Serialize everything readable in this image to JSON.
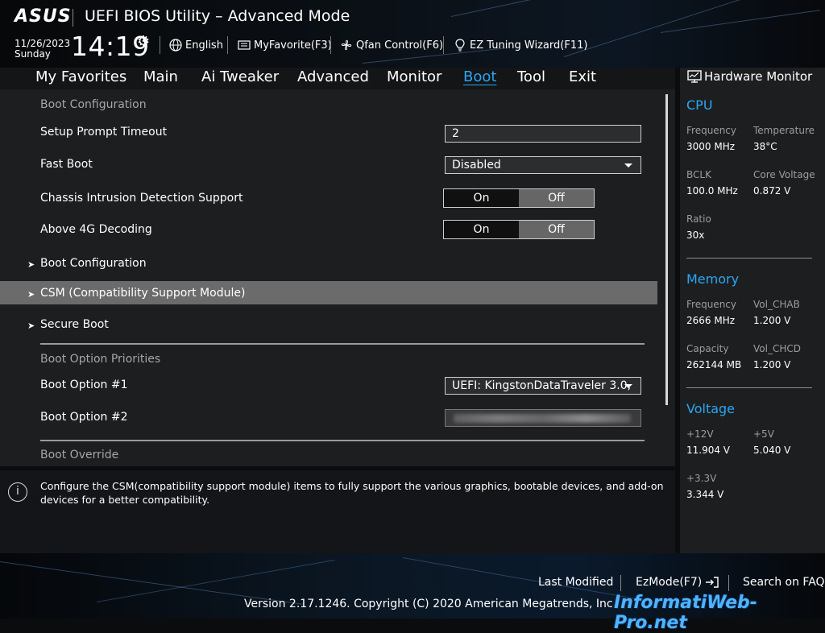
{
  "header": {
    "logo_text": "ASUS",
    "title": "UEFI BIOS Utility – Advanced Mode",
    "date": "11/26/2023",
    "day": "Sunday",
    "time": "14:19",
    "language_label": "English",
    "myfavorite_label": "MyFavorite(F3)",
    "qfan_label": "Qfan Control(F6)",
    "ez_tuning_label": "EZ Tuning Wizard(F11)"
  },
  "nav": {
    "tabs": [
      "My Favorites",
      "Main",
      "Ai Tweaker",
      "Advanced",
      "Monitor",
      "Boot",
      "Tool",
      "Exit"
    ],
    "active": "Boot"
  },
  "boot": {
    "section_boot_configuration": "Boot Configuration",
    "setup_prompt_timeout": {
      "label": "Setup Prompt Timeout",
      "value": "2"
    },
    "fast_boot": {
      "label": "Fast Boot",
      "value": "Disabled"
    },
    "chassis_intrusion": {
      "label": "Chassis Intrusion Detection Support",
      "on": "On",
      "off": "Off",
      "selected": "Off"
    },
    "above_4g": {
      "label": "Above 4G Decoding",
      "on": "On",
      "off": "Off",
      "selected": "Off"
    },
    "submenus": [
      "Boot Configuration",
      "CSM (Compatibility Support Module)",
      "Secure Boot"
    ],
    "highlighted_submenu": "CSM (Compatibility Support Module)",
    "section_boot_option_priorities": "Boot Option Priorities",
    "boot_option_1": {
      "label": "Boot Option #1",
      "value": "UEFI: KingstonDataTraveler 3.0,"
    },
    "boot_option_2": {
      "label": "Boot Option #2"
    },
    "section_boot_override": "Boot Override"
  },
  "help": {
    "text": "Configure the CSM(compatibility support module) items to fully support the various graphics, bootable devices, and add-on devices for a better compatibility."
  },
  "hardware_monitor": {
    "title": "Hardware Monitor",
    "cpu": {
      "heading": "CPU",
      "frequency_label": "Frequency",
      "frequency": "3000 MHz",
      "temperature_label": "Temperature",
      "temperature": "38°C",
      "bclk_label": "BCLK",
      "bclk": "100.0 MHz",
      "core_voltage_label": "Core Voltage",
      "core_voltage": "0.872 V",
      "ratio_label": "Ratio",
      "ratio": "30x"
    },
    "memory": {
      "heading": "Memory",
      "frequency_label": "Frequency",
      "frequency": "2666 MHz",
      "vol_chab_label": "Vol_CHAB",
      "vol_chab": "1.200 V",
      "capacity_label": "Capacity",
      "capacity": "262144 MB",
      "vol_chcd_label": "Vol_CHCD",
      "vol_chcd": "1.200 V"
    },
    "voltage": {
      "heading": "Voltage",
      "v12_label": "+12V",
      "v12": "11.904 V",
      "v5_label": "+5V",
      "v5": "5.040 V",
      "v33_label": "+3.3V",
      "v33": "3.344 V"
    }
  },
  "footer": {
    "last_modified": "Last Modified",
    "ezmode": "EzMode(F7)",
    "search_faq": "Search on FAQ",
    "copyright": "Version 2.17.1246. Copyright (C) 2020 American Megatrends, Inc.",
    "watermark": "InformatiWeb-Pro.net"
  },
  "colors": {
    "accent": "#2aa7f5",
    "panel": "#1d1e20",
    "highlight": "#6b6b6b"
  }
}
